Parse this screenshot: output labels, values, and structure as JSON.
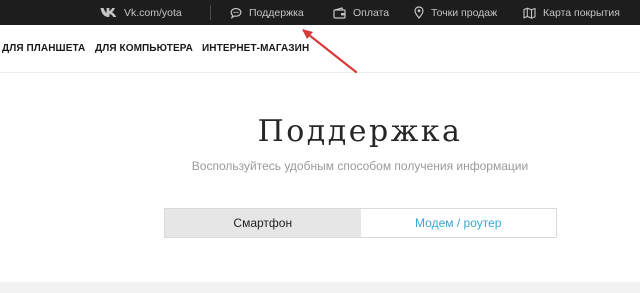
{
  "topbar": {
    "vk_label": "Vk.com/yota",
    "links": [
      {
        "label": "Поддержка",
        "icon": "chat-bubble-icon"
      },
      {
        "label": "Оплата",
        "icon": "wallet-icon"
      },
      {
        "label": "Точки продаж",
        "icon": "location-pin-icon"
      },
      {
        "label": "Карта покрытия",
        "icon": "map-icon"
      }
    ]
  },
  "nav": {
    "items": [
      "ДЛЯ ПЛАНШЕТА",
      "ДЛЯ КОМПЬЮТЕРА",
      "ИНТЕРНЕТ-МАГАЗИН"
    ]
  },
  "main": {
    "title": "Поддержка",
    "subtitle": "Воспользуйтесь удобным способом получения информации",
    "tabs": [
      {
        "label": "Смартфон",
        "state": "active"
      },
      {
        "label": "Модем / роутер",
        "state": "inactive"
      }
    ]
  },
  "colors": {
    "topbar_bg": "#1d1d1d",
    "link_blue": "#3aa7d6",
    "annotation_arrow": "#d93a3a"
  }
}
